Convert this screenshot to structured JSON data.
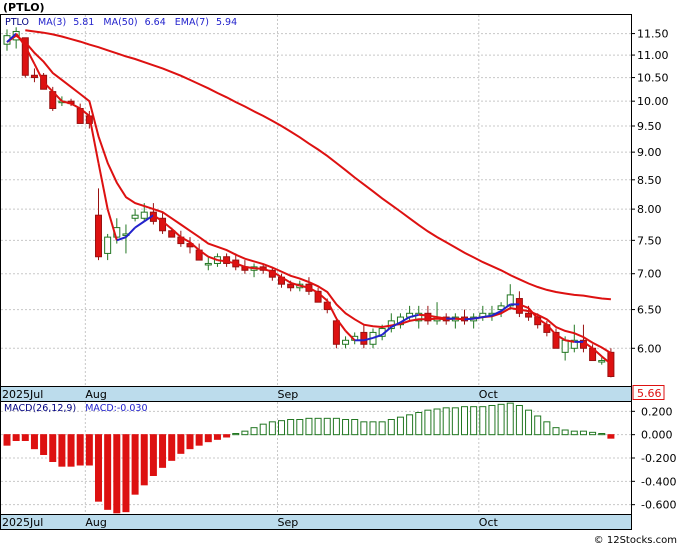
{
  "header": {
    "ticker_label": "(PTLO)",
    "watermark": "© 12Stocks.com"
  },
  "indicators": {
    "ma3": {
      "label": "MA(3)",
      "value": "5.81",
      "color": "#2222cc"
    },
    "ma50": {
      "label": "MA(50)",
      "value": "6.64",
      "color": "#dd1111"
    },
    "ema7": {
      "label": "EMA(7)",
      "value": "5.94",
      "color": "#dd1111"
    }
  },
  "macd_legend": {
    "label": "MACD(26,12,9)",
    "value_label": "MACD:-0.030"
  },
  "last_price_badge": "5.66",
  "colors": {
    "up_candle_fill": "#ffffff",
    "up_candle_stroke": "#227722",
    "down_candle_fill": "#dd1111",
    "down_candle_stroke": "#991111",
    "macd_positive": "#227722",
    "macd_negative": "#dd1111",
    "axis_bar_bg": "#bcdcec",
    "grid": "#c8c8c8"
  },
  "chart_data": [
    {
      "type": "candlestick",
      "title": "(PTLO)",
      "x_labels": [
        "2025Jul",
        "Aug",
        "Sep",
        "Oct"
      ],
      "y_ticks": [
        6.0,
        6.5,
        7.0,
        7.5,
        8.0,
        8.5,
        9.0,
        9.5,
        10.0,
        10.5,
        11.0,
        11.5
      ],
      "y_tick_labels": [
        "6.00",
        "6.50",
        "7.00",
        "7.50",
        "8.00",
        "8.50",
        "9.00",
        "9.50",
        "10.00",
        "10.50",
        "11.00",
        "11.50"
      ],
      "y_scale": "log",
      "ylim": [
        5.55,
        11.95
      ],
      "grid": true,
      "candles": [
        {
          "d": "Jul 28",
          "o": 11.25,
          "h": 11.6,
          "l": 11.1,
          "c": 11.45
        },
        {
          "d": "Jul 29",
          "o": 11.35,
          "h": 11.65,
          "l": 11.15,
          "c": 11.55
        },
        {
          "d": "Jul 30",
          "o": 11.4,
          "h": 11.4,
          "l": 10.5,
          "c": 10.55
        },
        {
          "d": "Jul 31",
          "o": 10.55,
          "h": 10.7,
          "l": 10.4,
          "c": 10.5
        },
        {
          "d": "Aug 1",
          "o": 10.55,
          "h": 10.6,
          "l": 10.25,
          "c": 10.25
        },
        {
          "d": "Aug 4",
          "o": 10.2,
          "h": 10.3,
          "l": 9.8,
          "c": 9.85
        },
        {
          "d": "Aug 5",
          "o": 10.0,
          "h": 10.1,
          "l": 9.9,
          "c": 10.0
        },
        {
          "d": "Aug 6",
          "o": 10.0,
          "h": 10.05,
          "l": 9.9,
          "c": 9.95
        },
        {
          "d": "Aug 7",
          "o": 9.85,
          "h": 9.95,
          "l": 9.55,
          "c": 9.55
        },
        {
          "d": "Aug 8",
          "o": 9.7,
          "h": 9.8,
          "l": 9.45,
          "c": 9.55
        },
        {
          "d": "Aug 11",
          "o": 7.9,
          "h": 8.35,
          "l": 7.2,
          "c": 7.25
        },
        {
          "d": "Aug 12",
          "o": 7.3,
          "h": 7.6,
          "l": 7.2,
          "c": 7.55
        },
        {
          "d": "Aug 13",
          "o": 7.55,
          "h": 7.85,
          "l": 7.45,
          "c": 7.7
        },
        {
          "d": "Aug 14",
          "o": 7.6,
          "h": 7.75,
          "l": 7.3,
          "c": 7.6
        },
        {
          "d": "Aug 15",
          "o": 7.85,
          "h": 8.0,
          "l": 7.8,
          "c": 7.9
        },
        {
          "d": "Aug 18",
          "o": 7.85,
          "h": 8.1,
          "l": 7.8,
          "c": 7.95
        },
        {
          "d": "Aug 19",
          "o": 7.95,
          "h": 8.1,
          "l": 7.75,
          "c": 7.8
        },
        {
          "d": "Aug 20",
          "o": 7.85,
          "h": 7.95,
          "l": 7.6,
          "c": 7.65
        },
        {
          "d": "Aug 21",
          "o": 7.65,
          "h": 7.7,
          "l": 7.55,
          "c": 7.55
        },
        {
          "d": "Aug 22",
          "o": 7.55,
          "h": 7.65,
          "l": 7.4,
          "c": 7.45
        },
        {
          "d": "Aug 25",
          "o": 7.45,
          "h": 7.55,
          "l": 7.3,
          "c": 7.4
        },
        {
          "d": "Aug 26",
          "o": 7.35,
          "h": 7.45,
          "l": 7.2,
          "c": 7.2
        },
        {
          "d": "Aug 27",
          "o": 7.15,
          "h": 7.25,
          "l": 7.05,
          "c": 7.15
        },
        {
          "d": "Aug 28",
          "o": 7.15,
          "h": 7.3,
          "l": 7.1,
          "c": 7.25
        },
        {
          "d": "Aug 29",
          "o": 7.25,
          "h": 7.3,
          "l": 7.1,
          "c": 7.15
        },
        {
          "d": "Sep 2",
          "o": 7.2,
          "h": 7.3,
          "l": 7.05,
          "c": 7.1
        },
        {
          "d": "Sep 3",
          "o": 7.1,
          "h": 7.2,
          "l": 7.0,
          "c": 7.05
        },
        {
          "d": "Sep 4",
          "o": 7.05,
          "h": 7.15,
          "l": 6.95,
          "c": 7.1
        },
        {
          "d": "Sep 5",
          "o": 7.1,
          "h": 7.15,
          "l": 7.0,
          "c": 7.05
        },
        {
          "d": "Sep 8",
          "o": 7.05,
          "h": 7.1,
          "l": 6.9,
          "c": 6.95
        },
        {
          "d": "Sep 9",
          "o": 6.95,
          "h": 7.0,
          "l": 6.8,
          "c": 6.85
        },
        {
          "d": "Sep 10",
          "o": 6.85,
          "h": 6.9,
          "l": 6.75,
          "c": 6.8
        },
        {
          "d": "Sep 11",
          "o": 6.8,
          "h": 6.9,
          "l": 6.75,
          "c": 6.85
        },
        {
          "d": "Sep 12",
          "o": 6.85,
          "h": 6.95,
          "l": 6.7,
          "c": 6.75
        },
        {
          "d": "Sep 15",
          "o": 6.75,
          "h": 6.8,
          "l": 6.6,
          "c": 6.6
        },
        {
          "d": "Sep 16",
          "o": 6.6,
          "h": 6.65,
          "l": 6.45,
          "c": 6.5
        },
        {
          "d": "Sep 17",
          "o": 6.35,
          "h": 6.4,
          "l": 6.0,
          "c": 6.05
        },
        {
          "d": "Sep 18",
          "o": 6.05,
          "h": 6.15,
          "l": 6.0,
          "c": 6.1
        },
        {
          "d": "Sep 19",
          "o": 6.1,
          "h": 6.2,
          "l": 6.05,
          "c": 6.15
        },
        {
          "d": "Sep 22",
          "o": 6.2,
          "h": 6.3,
          "l": 6.0,
          "c": 6.05
        },
        {
          "d": "Sep 23",
          "o": 6.05,
          "h": 6.25,
          "l": 6.0,
          "c": 6.2
        },
        {
          "d": "Sep 24",
          "o": 6.15,
          "h": 6.3,
          "l": 6.1,
          "c": 6.25
        },
        {
          "d": "Sep 25",
          "o": 6.25,
          "h": 6.45,
          "l": 6.2,
          "c": 6.35
        },
        {
          "d": "Sep 26",
          "o": 6.3,
          "h": 6.45,
          "l": 6.25,
          "c": 6.4
        },
        {
          "d": "Sep 29",
          "o": 6.4,
          "h": 6.55,
          "l": 6.35,
          "c": 6.45
        },
        {
          "d": "Sep 30",
          "o": 6.35,
          "h": 6.55,
          "l": 6.25,
          "c": 6.45
        },
        {
          "d": "Oct 1",
          "o": 6.45,
          "h": 6.55,
          "l": 6.3,
          "c": 6.35
        },
        {
          "d": "Oct 2",
          "o": 6.35,
          "h": 6.6,
          "l": 6.3,
          "c": 6.4
        },
        {
          "d": "Oct 3",
          "o": 6.4,
          "h": 6.45,
          "l": 6.3,
          "c": 6.35
        },
        {
          "d": "Oct 6",
          "o": 6.35,
          "h": 6.45,
          "l": 6.25,
          "c": 6.4
        },
        {
          "d": "Oct 7",
          "o": 6.4,
          "h": 6.5,
          "l": 6.3,
          "c": 6.35
        },
        {
          "d": "Oct 8",
          "o": 6.35,
          "h": 6.45,
          "l": 6.25,
          "c": 6.4
        },
        {
          "d": "Oct 9",
          "o": 6.4,
          "h": 6.55,
          "l": 6.35,
          "c": 6.45
        },
        {
          "d": "Oct 10",
          "o": 6.45,
          "h": 6.55,
          "l": 6.35,
          "c": 6.45
        },
        {
          "d": "Oct 13",
          "o": 6.5,
          "h": 6.6,
          "l": 6.4,
          "c": 6.55
        },
        {
          "d": "Oct 14",
          "o": 6.55,
          "h": 6.85,
          "l": 6.5,
          "c": 6.7
        },
        {
          "d": "Oct 15",
          "o": 6.65,
          "h": 6.75,
          "l": 6.4,
          "c": 6.45
        },
        {
          "d": "Oct 16",
          "o": 6.45,
          "h": 6.55,
          "l": 6.35,
          "c": 6.4
        },
        {
          "d": "Oct 17",
          "o": 6.4,
          "h": 6.45,
          "l": 6.25,
          "c": 6.3
        },
        {
          "d": "Oct 20",
          "o": 6.3,
          "h": 6.35,
          "l": 6.15,
          "c": 6.2
        },
        {
          "d": "Oct 21",
          "o": 6.2,
          "h": 6.25,
          "l": 6.0,
          "c": 6.0
        },
        {
          "d": "Oct 22",
          "o": 5.95,
          "h": 6.15,
          "l": 5.85,
          "c": 6.1
        },
        {
          "d": "Oct 23",
          "o": 6.0,
          "h": 6.3,
          "l": 5.95,
          "c": 6.1
        },
        {
          "d": "Oct 24",
          "o": 6.1,
          "h": 6.3,
          "l": 5.95,
          "c": 6.0
        },
        {
          "d": "Oct 27",
          "o": 6.0,
          "h": 6.05,
          "l": 5.85,
          "c": 5.85
        },
        {
          "d": "Oct 28",
          "o": 5.85,
          "h": 5.9,
          "l": 5.8,
          "c": 5.85
        },
        {
          "d": "Oct 29",
          "o": 5.95,
          "h": 6.0,
          "l": 5.65,
          "c": 5.66
        }
      ],
      "ma3_series": [
        11.3,
        11.5,
        11.2,
        10.8,
        10.4,
        10.2,
        10.0,
        9.95,
        9.85,
        9.7,
        8.8,
        8.0,
        7.5,
        7.55,
        7.7,
        7.8,
        7.9,
        7.8,
        7.68,
        7.55,
        7.47,
        7.35,
        7.25,
        7.2,
        7.18,
        7.15,
        7.1,
        7.08,
        7.07,
        7.03,
        6.95,
        6.87,
        6.83,
        6.8,
        6.73,
        6.62,
        6.38,
        6.22,
        6.1,
        6.1,
        6.13,
        6.17,
        6.27,
        6.33,
        6.4,
        6.43,
        6.42,
        6.4,
        6.38,
        6.38,
        6.37,
        6.38,
        6.4,
        6.42,
        6.48,
        6.57,
        6.57,
        6.52,
        6.38,
        6.3,
        6.17,
        6.1,
        6.08,
        6.08,
        6.0,
        5.9,
        5.81
      ],
      "ma50_series": [
        null,
        null,
        11.58,
        11.55,
        11.52,
        11.48,
        11.43,
        11.37,
        11.31,
        11.24,
        11.18,
        11.11,
        11.04,
        10.97,
        10.91,
        10.84,
        10.77,
        10.7,
        10.62,
        10.54,
        10.45,
        10.36,
        10.27,
        10.17,
        10.08,
        9.98,
        9.89,
        9.79,
        9.7,
        9.6,
        9.5,
        9.39,
        9.28,
        9.16,
        9.05,
        8.93,
        8.8,
        8.67,
        8.54,
        8.42,
        8.3,
        8.18,
        8.07,
        7.96,
        7.85,
        7.74,
        7.64,
        7.55,
        7.47,
        7.39,
        7.31,
        7.24,
        7.17,
        7.11,
        7.05,
        6.98,
        6.92,
        6.86,
        6.81,
        6.77,
        6.74,
        6.72,
        6.7,
        6.69,
        6.67,
        6.65,
        6.64
      ],
      "ema7_series": [
        11.3,
        11.45,
        11.3,
        11.05,
        10.85,
        10.6,
        10.45,
        10.3,
        10.15,
        10.0,
        9.3,
        8.8,
        8.45,
        8.2,
        8.1,
        8.05,
        8.0,
        7.95,
        7.85,
        7.75,
        7.65,
        7.55,
        7.45,
        7.4,
        7.35,
        7.28,
        7.22,
        7.18,
        7.14,
        7.09,
        7.03,
        6.97,
        6.93,
        6.88,
        6.82,
        6.74,
        6.57,
        6.45,
        6.37,
        6.3,
        6.28,
        6.27,
        6.29,
        6.31,
        6.35,
        6.37,
        6.37,
        6.38,
        6.37,
        6.38,
        6.37,
        6.38,
        6.4,
        6.41,
        6.45,
        6.52,
        6.5,
        6.48,
        6.43,
        6.37,
        6.27,
        6.22,
        6.19,
        6.14,
        6.07,
        6.01,
        5.94
      ]
    },
    {
      "type": "bar",
      "title": "MACD(26,12,9)",
      "x_labels": [
        "2025Jul",
        "Aug",
        "Sep",
        "Oct"
      ],
      "y_tick_labels": [
        "0.200",
        "0.000",
        "-0.200",
        "-0.400",
        "-0.600"
      ],
      "y_ticks": [
        0.2,
        0.0,
        -0.2,
        -0.4,
        -0.6
      ],
      "ylim": [
        -0.68,
        0.28
      ],
      "grid": true,
      "values": [
        -0.09,
        -0.05,
        -0.05,
        -0.12,
        -0.17,
        -0.23,
        -0.27,
        -0.27,
        -0.26,
        -0.26,
        -0.57,
        -0.64,
        -0.67,
        -0.66,
        -0.51,
        -0.43,
        -0.35,
        -0.28,
        -0.22,
        -0.16,
        -0.12,
        -0.09,
        -0.06,
        -0.04,
        -0.02,
        0.01,
        0.03,
        0.06,
        0.09,
        0.11,
        0.12,
        0.13,
        0.13,
        0.14,
        0.14,
        0.14,
        0.14,
        0.13,
        0.13,
        0.11,
        0.11,
        0.11,
        0.13,
        0.15,
        0.17,
        0.19,
        0.21,
        0.22,
        0.23,
        0.23,
        0.24,
        0.24,
        0.24,
        0.25,
        0.26,
        0.27,
        0.25,
        0.21,
        0.16,
        0.11,
        0.06,
        0.04,
        0.03,
        0.03,
        0.02,
        0.01,
        -0.03
      ]
    }
  ]
}
